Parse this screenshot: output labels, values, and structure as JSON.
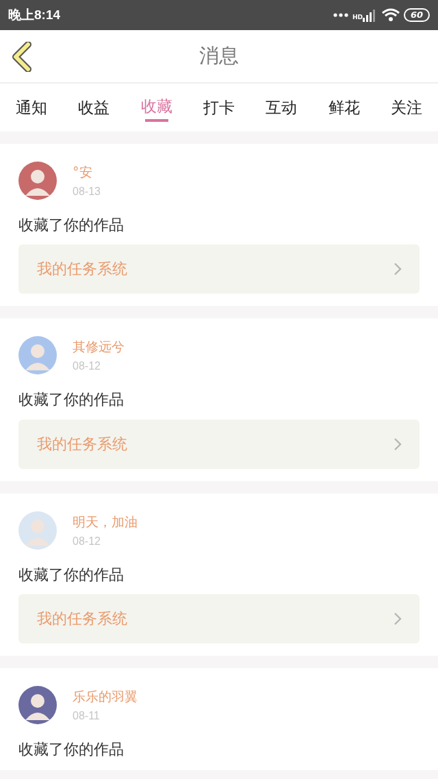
{
  "status_bar": {
    "time": "晚上8:14",
    "network": "HD",
    "battery": "60"
  },
  "header": {
    "title": "消息"
  },
  "tabs": [
    {
      "label": "通知",
      "selected": false
    },
    {
      "label": "收益",
      "selected": false
    },
    {
      "label": "收藏",
      "selected": true
    },
    {
      "label": "打卡",
      "selected": false
    },
    {
      "label": "互动",
      "selected": false
    },
    {
      "label": "鲜花",
      "selected": false
    },
    {
      "label": "关注",
      "selected": false
    }
  ],
  "messages": [
    {
      "name": "°安",
      "date": "08-13",
      "text": "收藏了你的作品",
      "task": "我的任务系统"
    },
    {
      "name": "其修远兮",
      "date": "08-12",
      "text": "收藏了你的作品",
      "task": "我的任务系统"
    },
    {
      "name": "明天，加油",
      "date": "08-12",
      "text": "收藏了你的作品",
      "task": "我的任务系统"
    },
    {
      "name": "乐乐的羽翼",
      "date": "08-11",
      "text": "收藏了你的作品"
    }
  ]
}
